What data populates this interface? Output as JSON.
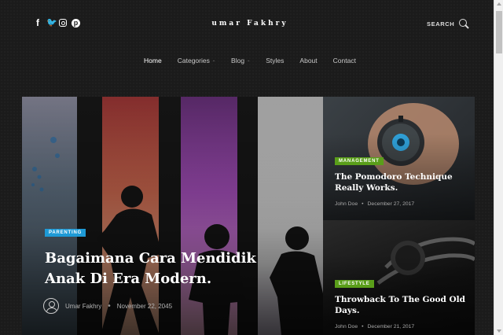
{
  "header": {
    "logo": "umar Fakhry",
    "social": [
      {
        "icon": "facebook-icon",
        "glyph": "f"
      },
      {
        "icon": "twitter-icon",
        "glyph": "🐦"
      },
      {
        "icon": "instagram-icon",
        "glyph": ""
      },
      {
        "icon": "pinterest-icon",
        "glyph": "p"
      }
    ],
    "search_label": "SEARCH"
  },
  "nav": [
    {
      "label": "Home",
      "active": true,
      "dropdown": false
    },
    {
      "label": "Categories",
      "active": false,
      "dropdown": true
    },
    {
      "label": "Blog",
      "active": false,
      "dropdown": true
    },
    {
      "label": "Styles",
      "active": false,
      "dropdown": false
    },
    {
      "label": "About",
      "active": false,
      "dropdown": false
    },
    {
      "label": "Contact",
      "active": false,
      "dropdown": false
    }
  ],
  "hero": {
    "category": "PARENTING",
    "category_color": "#1e9ad6",
    "title": "Bagaimana Cara Mendidik Anak Di Era Modern.",
    "author": "Umar Fakhry",
    "date": "November 22, 2045"
  },
  "cards": [
    {
      "category": "MANAGEMENT",
      "category_color": "#5a9e1a",
      "title": "The Pomodoro Technique Really Works.",
      "author": "John Doe",
      "date": "December 27, 2017"
    },
    {
      "category": "LIFESTYLE",
      "category_color": "#5a9e1a",
      "title": "Throwback To The Good Old Days.",
      "author": "John Doe",
      "date": "December 21, 2017"
    }
  ]
}
